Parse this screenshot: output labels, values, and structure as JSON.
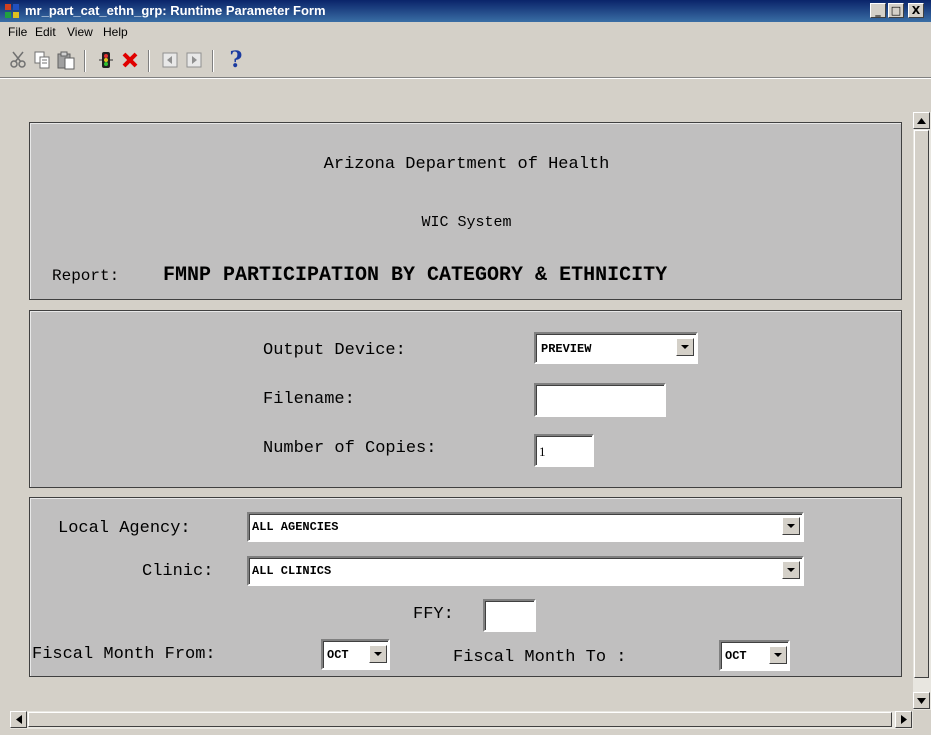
{
  "window": {
    "title": "mr_part_cat_ethn_grp: Runtime Parameter Form",
    "minimize": "_",
    "maximize": "□",
    "close": "X"
  },
  "menu": {
    "items": [
      {
        "label": "File"
      },
      {
        "label": "Edit"
      },
      {
        "label": "View"
      },
      {
        "label": "Help"
      }
    ]
  },
  "toolbar": {
    "icons": [
      "cut-icon",
      "copy-icon",
      "paste-icon",
      "run-icon",
      "cancel-icon",
      "previous-icon",
      "next-icon",
      "help-icon"
    ],
    "help_label": "?"
  },
  "header": {
    "organization": "Arizona Department of Health",
    "system": "WIC System",
    "report_prefix": "Report:",
    "report_name": "FMNP PARTICIPATION BY CATEGORY & ETHNICITY"
  },
  "output": {
    "device_label": "Output Device:",
    "device_value": "PREVIEW",
    "filename_label": "Filename:",
    "filename_value": "",
    "copies_label": "Number of Copies:",
    "copies_value": "1"
  },
  "params": {
    "agency_label": "Local Agency:",
    "agency_value": "ALL AGENCIES",
    "clinic_label": "Clinic:",
    "clinic_value": "ALL CLINICS",
    "ffy_label": "FFY:",
    "ffy_value": "",
    "month_from_label": "Fiscal Month From:",
    "month_from_value": "OCT",
    "month_to_label": "Fiscal Month To :",
    "month_to_value": "OCT"
  }
}
